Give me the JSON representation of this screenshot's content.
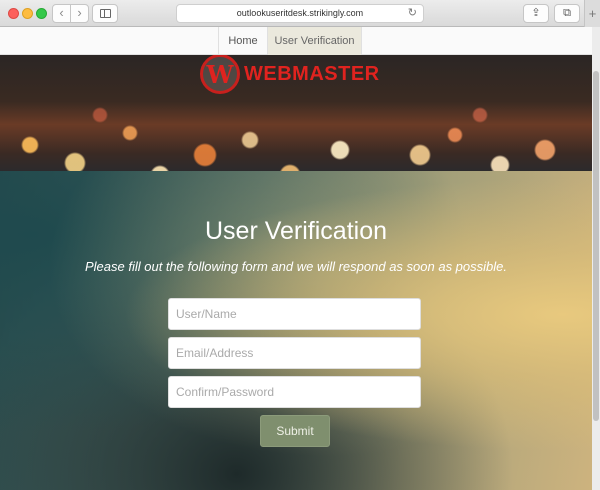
{
  "browser": {
    "url": "outlookuseritdesk.strikingly.com",
    "back_icon": "chevron-left-icon",
    "forward_icon": "chevron-right-icon",
    "reload_icon": "reload-icon",
    "share_icon": "share-icon",
    "tabs_icon": "tabs-icon",
    "newtab_label": "+"
  },
  "nav": {
    "items": [
      {
        "label": "Home"
      },
      {
        "label": "User Verification"
      }
    ]
  },
  "logo": {
    "mark": "W",
    "text": "WEBMASTER",
    "color": "#e0231f"
  },
  "hero": {
    "title": "User Verification",
    "subtitle": "Please fill out the following form and we will respond as soon as possible."
  },
  "form": {
    "user_placeholder": "User/Name",
    "email_placeholder": "Email/Address",
    "password_placeholder": "Confirm/Password",
    "submit_label": "Submit",
    "submit_color": "#7f8f6e"
  }
}
